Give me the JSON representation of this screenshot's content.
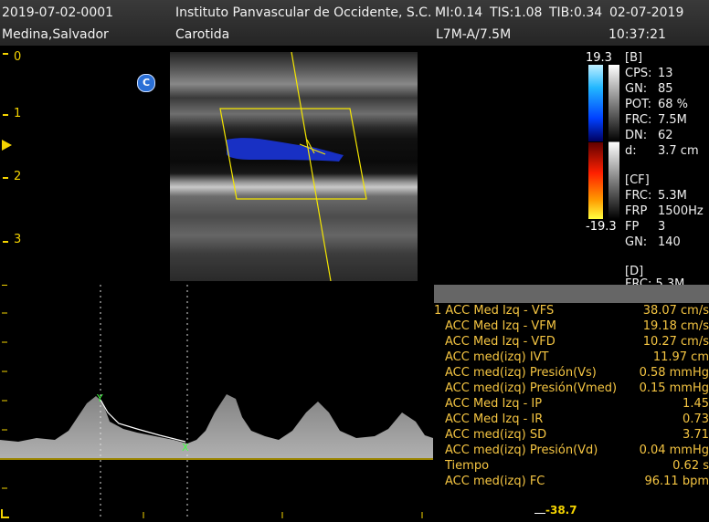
{
  "header": {
    "study_id": "2019-07-02-0001",
    "institution": "Instituto Panvascular de Occidente, S.C.",
    "mi": "MI:0.14",
    "tis": "TIS:1.08",
    "tib": "TIB:0.34",
    "date": "02-07-2019",
    "patient": "Medina,Salvador",
    "exam": "Carotida",
    "probe": "L7M-A/7.5M",
    "time": "10:37:21"
  },
  "depth_scale": [
    "0",
    "1",
    "2",
    "3"
  ],
  "mode_badge": "C",
  "color_scale": {
    "top": "19.3",
    "bottom": "-19.3"
  },
  "b_params": {
    "title": "[B]",
    "rows": [
      {
        "k": "CPS:",
        "v": "13"
      },
      {
        "k": "GN:",
        "v": "85"
      },
      {
        "k": "POT:",
        "v": "68 %"
      },
      {
        "k": "FRC:",
        "v": "7.5M"
      },
      {
        "k": "DN:",
        "v": "62"
      },
      {
        "k": "d:",
        "v": "3.7 cm"
      }
    ]
  },
  "cf_params": {
    "title": "[CF]",
    "rows": [
      {
        "k": "FRC:",
        "v": "5.3M"
      },
      {
        "k": "FRP",
        "v": "1500Hz"
      },
      {
        "k": "FP",
        "v": "3"
      },
      {
        "k": "GN:",
        "v": "140"
      }
    ]
  },
  "d_params": {
    "title": "[D]",
    "partial": "FRC: 5.3M"
  },
  "measurements": [
    {
      "label": "1 ACC  Med Izq - VFS",
      "value": "38.07 cm/s"
    },
    {
      "label": "ACC Med Izq - VFM",
      "value": "19.18 cm/s"
    },
    {
      "label": "ACC Med Izq - VFD",
      "value": "10.27 cm/s"
    },
    {
      "label": "ACC med(izq) IVT",
      "value": "11.97 cm"
    },
    {
      "label": "ACC med(izq) Presión(Vs)",
      "value": "0.58 mmHg"
    },
    {
      "label": "ACC med(izq) Presión(Vmed)",
      "value": "0.15 mmHg"
    },
    {
      "label": "ACC Med Izq - IP",
      "value": "1.45"
    },
    {
      "label": "ACC Med Izq - IR",
      "value": "0.73"
    },
    {
      "label": "ACC med(izq) SD",
      "value": "3.71"
    },
    {
      "label": "ACC med(izq) Presión(Vd)",
      "value": "0.04 mmHg"
    },
    {
      "label": "Tiempo",
      "value": "0.62 s"
    },
    {
      "label": "ACC med(izq) FC",
      "value": "96.11 bpm"
    }
  ],
  "spectrum": {
    "bottom_scale": "-38.7",
    "marker_peak": "Y",
    "marker_end": "X"
  },
  "colors": {
    "accent": "#f5d400",
    "measure_text": "#f5c542",
    "doppler_blue": "#1a34d8"
  }
}
